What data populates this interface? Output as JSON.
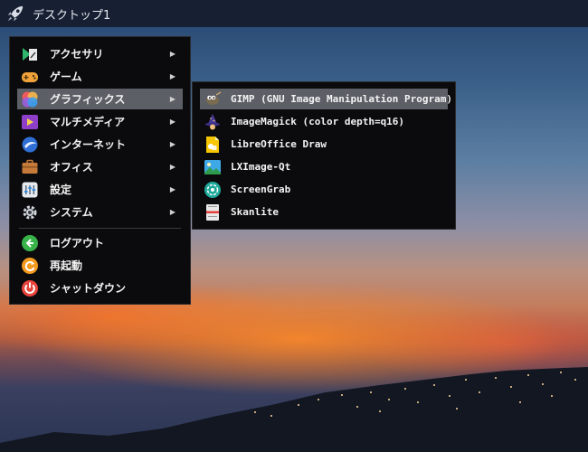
{
  "taskbar": {
    "title": "デスクトップ1",
    "icon": "rocket-icon"
  },
  "main_menu": {
    "items": [
      {
        "label": "アクセサリ",
        "icon": "accessories-icon",
        "submenu": true
      },
      {
        "label": "ゲーム",
        "icon": "games-icon",
        "submenu": true
      },
      {
        "label": "グラフィックス",
        "icon": "graphics-icon",
        "submenu": true,
        "active": true
      },
      {
        "label": "マルチメディア",
        "icon": "multimedia-icon",
        "submenu": true
      },
      {
        "label": "インターネット",
        "icon": "internet-icon",
        "submenu": true
      },
      {
        "label": "オフィス",
        "icon": "office-icon",
        "submenu": true
      },
      {
        "label": "設定",
        "icon": "settings-icon",
        "submenu": true
      },
      {
        "label": "システム",
        "icon": "system-icon",
        "submenu": true
      }
    ],
    "actions": [
      {
        "label": "ログアウト",
        "icon": "logout-icon"
      },
      {
        "label": "再起動",
        "icon": "reboot-icon"
      },
      {
        "label": "シャットダウン",
        "icon": "shutdown-icon"
      }
    ],
    "arrow": "▶"
  },
  "graphics_submenu": {
    "items": [
      {
        "label": "GIMP (GNU Image Manipulation Program)",
        "icon": "gimp-icon",
        "active": true
      },
      {
        "label": "ImageMagick (color depth=q16)",
        "icon": "imagemagick-icon"
      },
      {
        "label": "LibreOffice Draw",
        "icon": "libreoffice-draw-icon"
      },
      {
        "label": "LXImage-Qt",
        "icon": "lximage-icon"
      },
      {
        "label": "ScreenGrab",
        "icon": "screengrab-icon"
      },
      {
        "label": "Skanlite",
        "icon": "skanlite-icon"
      }
    ]
  },
  "colors": {
    "menu_bg": "#0b0b0d",
    "highlight": "#5c5f66",
    "taskbar_bg": "#172033"
  }
}
